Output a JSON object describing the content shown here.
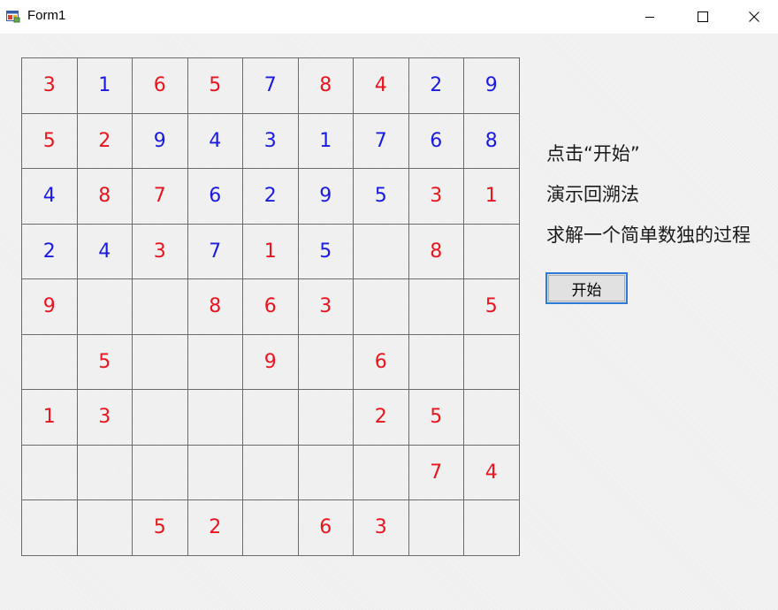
{
  "window": {
    "title": "Form1",
    "icon": "winforms-app-icon"
  },
  "titlebar_buttons": {
    "minimize": "minimize-icon",
    "maximize": "maximize-icon",
    "close": "close-icon"
  },
  "colors": {
    "given_digit": "#e8141e",
    "solved_digit": "#1a1ae0",
    "button_border": "#2d7bd4"
  },
  "sudoku": {
    "rows": [
      [
        {
          "v": "3",
          "c": "red"
        },
        {
          "v": "1",
          "c": "blue"
        },
        {
          "v": "6",
          "c": "red"
        },
        {
          "v": "5",
          "c": "red"
        },
        {
          "v": "7",
          "c": "blue"
        },
        {
          "v": "8",
          "c": "red"
        },
        {
          "v": "4",
          "c": "red"
        },
        {
          "v": "2",
          "c": "blue"
        },
        {
          "v": "9",
          "c": "blue"
        }
      ],
      [
        {
          "v": "5",
          "c": "red"
        },
        {
          "v": "2",
          "c": "red"
        },
        {
          "v": "9",
          "c": "blue"
        },
        {
          "v": "4",
          "c": "blue"
        },
        {
          "v": "3",
          "c": "blue"
        },
        {
          "v": "1",
          "c": "blue"
        },
        {
          "v": "7",
          "c": "blue"
        },
        {
          "v": "6",
          "c": "blue"
        },
        {
          "v": "8",
          "c": "blue"
        }
      ],
      [
        {
          "v": "4",
          "c": "blue"
        },
        {
          "v": "8",
          "c": "red"
        },
        {
          "v": "7",
          "c": "red"
        },
        {
          "v": "6",
          "c": "blue"
        },
        {
          "v": "2",
          "c": "blue"
        },
        {
          "v": "9",
          "c": "blue"
        },
        {
          "v": "5",
          "c": "blue"
        },
        {
          "v": "3",
          "c": "red"
        },
        {
          "v": "1",
          "c": "red"
        }
      ],
      [
        {
          "v": "2",
          "c": "blue"
        },
        {
          "v": "4",
          "c": "blue"
        },
        {
          "v": "3",
          "c": "red"
        },
        {
          "v": "7",
          "c": "blue"
        },
        {
          "v": "1",
          "c": "red"
        },
        {
          "v": "5",
          "c": "blue"
        },
        {
          "v": "",
          "c": ""
        },
        {
          "v": "8",
          "c": "red"
        },
        {
          "v": "",
          "c": ""
        }
      ],
      [
        {
          "v": "9",
          "c": "red"
        },
        {
          "v": "",
          "c": ""
        },
        {
          "v": "",
          "c": ""
        },
        {
          "v": "8",
          "c": "red"
        },
        {
          "v": "6",
          "c": "red"
        },
        {
          "v": "3",
          "c": "red"
        },
        {
          "v": "",
          "c": ""
        },
        {
          "v": "",
          "c": ""
        },
        {
          "v": "5",
          "c": "red"
        }
      ],
      [
        {
          "v": "",
          "c": ""
        },
        {
          "v": "5",
          "c": "red"
        },
        {
          "v": "",
          "c": ""
        },
        {
          "v": "",
          "c": ""
        },
        {
          "v": "9",
          "c": "red"
        },
        {
          "v": "",
          "c": ""
        },
        {
          "v": "6",
          "c": "red"
        },
        {
          "v": "",
          "c": ""
        },
        {
          "v": "",
          "c": ""
        }
      ],
      [
        {
          "v": "1",
          "c": "red"
        },
        {
          "v": "3",
          "c": "red"
        },
        {
          "v": "",
          "c": ""
        },
        {
          "v": "",
          "c": ""
        },
        {
          "v": "",
          "c": ""
        },
        {
          "v": "",
          "c": ""
        },
        {
          "v": "2",
          "c": "red"
        },
        {
          "v": "5",
          "c": "red"
        },
        {
          "v": "",
          "c": ""
        }
      ],
      [
        {
          "v": "",
          "c": ""
        },
        {
          "v": "",
          "c": ""
        },
        {
          "v": "",
          "c": ""
        },
        {
          "v": "",
          "c": ""
        },
        {
          "v": "",
          "c": ""
        },
        {
          "v": "",
          "c": ""
        },
        {
          "v": "",
          "c": ""
        },
        {
          "v": "7",
          "c": "red"
        },
        {
          "v": "4",
          "c": "red"
        }
      ],
      [
        {
          "v": "",
          "c": ""
        },
        {
          "v": "",
          "c": ""
        },
        {
          "v": "5",
          "c": "red"
        },
        {
          "v": "2",
          "c": "red"
        },
        {
          "v": "",
          "c": ""
        },
        {
          "v": "6",
          "c": "red"
        },
        {
          "v": "3",
          "c": "red"
        },
        {
          "v": "",
          "c": ""
        },
        {
          "v": "",
          "c": ""
        }
      ]
    ]
  },
  "info": {
    "line1": "点击“开始”",
    "line2": "演示回溯法",
    "line3": "求解一个简单数独的过程"
  },
  "start_button": {
    "label": "开始"
  }
}
